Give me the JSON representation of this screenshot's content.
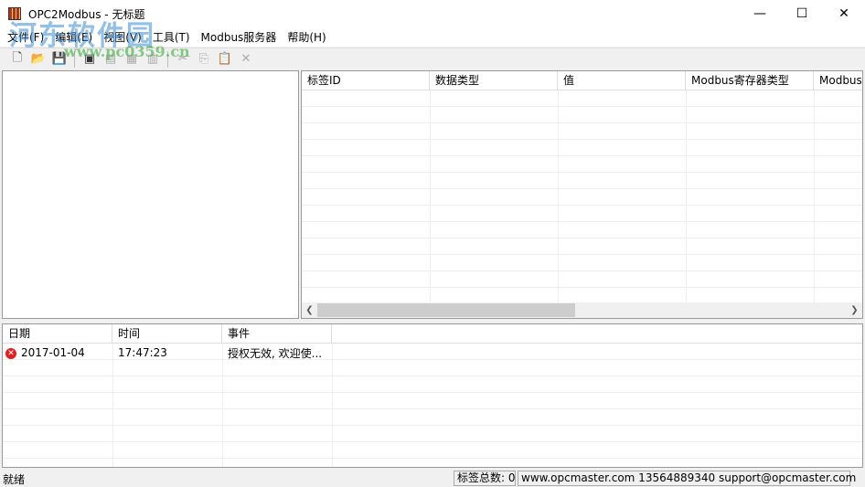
{
  "window": {
    "title": "OPC2Modbus - 无标题",
    "minimize": "—",
    "maximize": "☐",
    "close": "✕"
  },
  "menu": [
    "文件(F)",
    "编辑(E)",
    "视图(V)",
    "工具(T)",
    "Modbus服务器",
    "帮助(H)"
  ],
  "toolbar": [
    {
      "name": "new-icon",
      "glyph": "🗋",
      "enabled": true
    },
    {
      "name": "open-icon",
      "glyph": "📂",
      "enabled": true
    },
    {
      "name": "save-icon",
      "glyph": "💾",
      "enabled": false
    },
    {
      "name": "add-device-icon",
      "glyph": "▣",
      "enabled": true
    },
    {
      "name": "add-group-icon",
      "glyph": "▤",
      "enabled": false
    },
    {
      "name": "add-tag-icon",
      "glyph": "▦",
      "enabled": false
    },
    {
      "name": "properties-icon",
      "glyph": "▥",
      "enabled": false
    },
    {
      "name": "cut-icon",
      "glyph": "✂",
      "enabled": false
    },
    {
      "name": "copy-icon",
      "glyph": "⎘",
      "enabled": false
    },
    {
      "name": "paste-icon",
      "glyph": "📋",
      "enabled": false
    },
    {
      "name": "delete-icon",
      "glyph": "✕",
      "enabled": false
    }
  ],
  "tag_table": {
    "columns": [
      "标签ID",
      "数据类型",
      "值",
      "Modbus寄存器类型",
      "Modbus"
    ]
  },
  "event_log": {
    "columns": [
      "日期",
      "时间",
      "事件"
    ],
    "rows": [
      {
        "date": "2017-01-04",
        "time": "17:47:23",
        "event": "授权无效, 欢迎使..."
      }
    ]
  },
  "status": {
    "ready": "就绪",
    "tag_count": "标签总数: 0",
    "contact": "www.opcmaster.com 13564889340 support@opcmaster.com"
  },
  "watermark": {
    "name": "河东软件园",
    "url": "www.pc0359.cn"
  }
}
